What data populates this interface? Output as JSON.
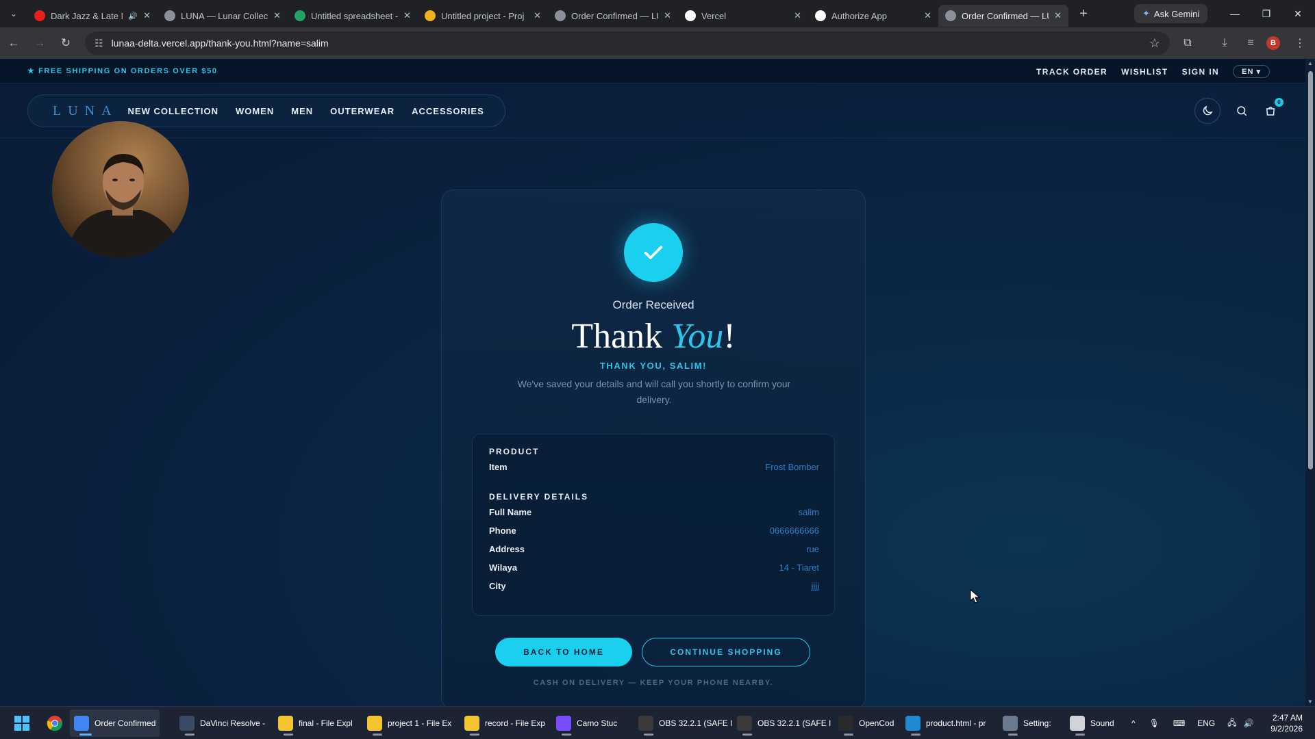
{
  "browser": {
    "tabs": [
      {
        "title": "Dark Jazz & Late Ni",
        "icon": "youtube-icon",
        "color": "#e62117"
      },
      {
        "title": "LUNA — Lunar Collect",
        "icon": "globe-icon",
        "color": "#8c9199"
      },
      {
        "title": "Untitled spreadsheet -",
        "icon": "sheets-icon",
        "color": "#1fa463"
      },
      {
        "title": "Untitled project - Proj",
        "icon": "project-icon",
        "color": "#f2b01e"
      },
      {
        "title": "Order Confirmed — LU",
        "icon": "globe-icon",
        "color": "#8c9199"
      },
      {
        "title": "Vercel",
        "icon": "vercel-icon",
        "color": "#ffffff"
      },
      {
        "title": "Authorize App",
        "icon": "vercel-icon",
        "color": "#ffffff"
      },
      {
        "title": "Order Confirmed — LU",
        "icon": "globe-icon",
        "color": "#8c9199"
      }
    ],
    "active_tab": 7,
    "gemini_label": "Ask Gemini",
    "url": "lunaa-delta.vercel.app/thank-you.html?name=salim",
    "profile_initial": "B"
  },
  "site": {
    "shipping_banner": "★ FREE SHIPPING ON ORDERS OVER $50",
    "top_links": [
      "TRACK ORDER",
      "WISHLIST",
      "SIGN IN"
    ],
    "language": "EN ▾",
    "logo": "LUNA",
    "nav": [
      "NEW COLLECTION",
      "WOMEN",
      "MEN",
      "OUTERWEAR",
      "ACCESSORIES"
    ],
    "cart_count": "0",
    "accent": "#1ad0ee"
  },
  "confirmation": {
    "eyebrow": "Order Received",
    "title_main": "Thank",
    "title_accent": "You",
    "title_end": "!",
    "thanks_name": "THANK YOU, SALIM!",
    "message": "We've saved your details and will call you shortly to confirm your delivery.",
    "product_heading": "PRODUCT",
    "product_rows": [
      {
        "label": "Item",
        "value": "Frost Bomber"
      }
    ],
    "delivery_heading": "DELIVERY DETAILS",
    "delivery_rows": [
      {
        "label": "Full Name",
        "value": "salim"
      },
      {
        "label": "Phone",
        "value": "0666666666"
      },
      {
        "label": "Address",
        "value": "rue"
      },
      {
        "label": "Wilaya",
        "value": "14 - Tiaret"
      },
      {
        "label": "City",
        "value": "jjjj"
      }
    ],
    "back_home": "BACK TO HOME",
    "continue_shopping": "CONTINUE SHOPPING",
    "cod_note": "CASH ON DELIVERY — KEEP YOUR PHONE NEARBY."
  },
  "taskbar": {
    "items": [
      {
        "label": "Order Confirmed",
        "icon": "chrome-icon",
        "color": "#4285f4",
        "active": true
      },
      {
        "label": "DaVinci Resolve -",
        "icon": "davinci-icon",
        "color": "#3b4a66"
      },
      {
        "label": "final - File Expl",
        "icon": "folder-icon",
        "color": "#f4c430"
      },
      {
        "label": "project 1 - File Ex",
        "icon": "folder-icon",
        "color": "#f4c430"
      },
      {
        "label": "record - File Exp",
        "icon": "folder-icon",
        "color": "#f4c430"
      },
      {
        "label": "Camo Stuc",
        "icon": "camo-icon",
        "color": "#7a4cff"
      },
      {
        "label": "OBS 32.2.1 (SAFE I",
        "icon": "obs-icon",
        "color": "#3a3a3a"
      },
      {
        "label": "OBS 32.2.1 (SAFE I",
        "icon": "obs-icon",
        "color": "#3a3a3a"
      },
      {
        "label": "OpenCod",
        "icon": "opencode-icon",
        "color": "#2b2b2b"
      },
      {
        "label": "product.html - pr",
        "icon": "vscode-icon",
        "color": "#1e8ad2"
      },
      {
        "label": "Setting:",
        "icon": "settings-icon",
        "color": "#6c7a90"
      },
      {
        "label": "Sound",
        "icon": "sound-icon",
        "color": "#d0d4da"
      }
    ],
    "lang": "ENG",
    "time": "2:47 AM",
    "date": "9/2/2026"
  }
}
